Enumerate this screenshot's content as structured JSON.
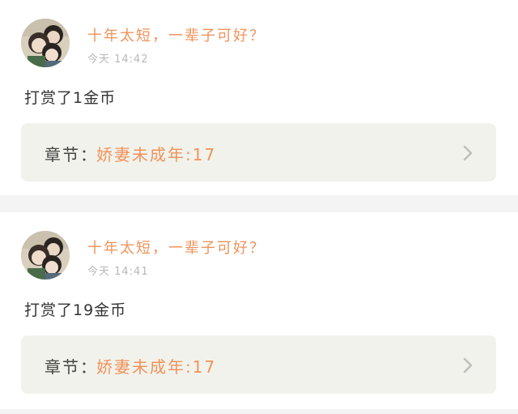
{
  "colors": {
    "accent": "#f0935a",
    "chapter_bg": "#f2f2ec",
    "separator": "#f4f4f4",
    "timestamp": "#b8b8b8",
    "body_text": "#333333"
  },
  "feed": [
    {
      "username": "十年太短，一辈子可好？",
      "time": "今天 14:42",
      "content": "打赏了1金币",
      "chapter_label": "章节：",
      "chapter_title": "娇妻未成年:17",
      "avatar_icon": "user-avatar-icon",
      "chevron_icon": "chevron-right-icon"
    },
    {
      "username": "十年太短，一辈子可好？",
      "time": "今天 14:41",
      "content": "打赏了19金币",
      "chapter_label": "章节：",
      "chapter_title": "娇妻未成年:17",
      "avatar_icon": "user-avatar-icon",
      "chevron_icon": "chevron-right-icon"
    }
  ]
}
